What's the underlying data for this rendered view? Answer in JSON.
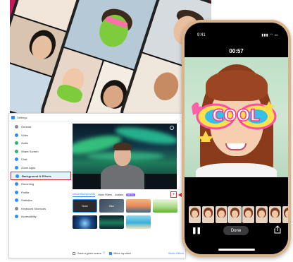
{
  "zoom_settings": {
    "window_title": "Settings",
    "sidebar_items": [
      {
        "label": "General",
        "icon": "gear-icon",
        "color": "#8a8a8a"
      },
      {
        "label": "Video",
        "icon": "video-icon",
        "color": "#2d8cff"
      },
      {
        "label": "Audio",
        "icon": "headphones-icon",
        "color": "#2fb36b"
      },
      {
        "label": "Share Screen",
        "icon": "share-screen-icon",
        "color": "#2fb36b"
      },
      {
        "label": "Chat",
        "icon": "chat-icon",
        "color": "#2d8cff"
      },
      {
        "label": "Zoom Apps",
        "icon": "apps-icon",
        "color": "#2d8cff"
      },
      {
        "label": "Background & Effects",
        "icon": "background-icon",
        "color": "#2d8cff"
      },
      {
        "label": "Recording",
        "icon": "record-icon",
        "color": "#2d8cff"
      },
      {
        "label": "Profile",
        "icon": "profile-icon",
        "color": "#2d8cff"
      },
      {
        "label": "Statistics",
        "icon": "statistics-icon",
        "color": "#2d8cff"
      },
      {
        "label": "Keyboard Shortcuts",
        "icon": "keyboard-icon",
        "color": "#8a8a8a"
      },
      {
        "label": "Accessibility",
        "icon": "accessibility-icon",
        "color": "#2d8cff"
      }
    ],
    "active_item": "Background & Effects",
    "tabs": [
      "Virtual Backgrounds",
      "Video Filters",
      "Avatars"
    ],
    "beta_badge": "BETA",
    "backgrounds": [
      {
        "label": "None"
      },
      {
        "label": "Blur"
      },
      {
        "label": ""
      },
      {
        "label": ""
      },
      {
        "label": ""
      },
      {
        "label": ""
      },
      {
        "label": ""
      }
    ],
    "green_screen_label": "I have a green screen",
    "mirror_label": "Mirror my video",
    "studio_effects_label": "Studio Effects"
  },
  "iphone": {
    "status_time": "9:41",
    "status_icons": "▮▮▮ ◠ ▭",
    "timer": "00:57",
    "sticker_text": "COOL",
    "done_label": "Done",
    "pause_icon": "pause-icon",
    "share_icon": "share-icon",
    "strip_count": 8,
    "selected_strip_index": 3
  },
  "colors": {
    "zoom_blue": "#2d8cff",
    "highlight_red": "#e0242f",
    "promo_pink": "#e91e63",
    "iphone_gold": "#d9b48a"
  }
}
